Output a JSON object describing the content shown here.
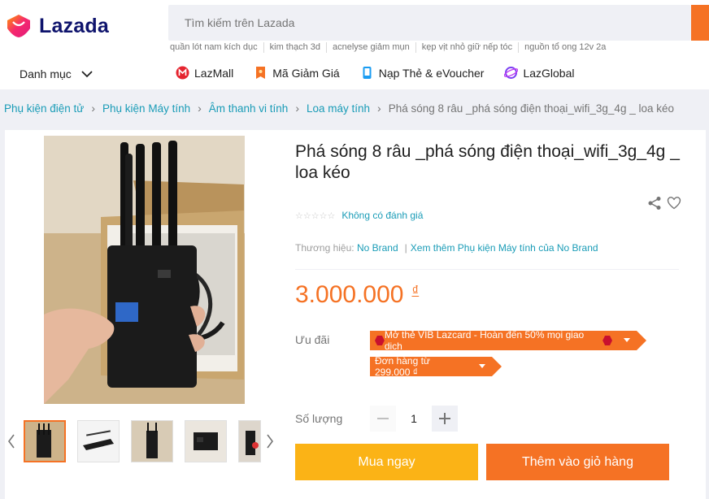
{
  "header": {
    "logo_text": "Lazada",
    "search_placeholder": "Tìm kiếm trên Lazada",
    "suggestions": [
      "quần lót nam kích dục",
      "kim thạch 3d",
      "acnelyse giảm mụn",
      "kẹp vịt nhỏ giữ nếp tóc",
      "nguồn tổ ong 12v 2a"
    ],
    "category_label": "Danh mục",
    "nav": [
      {
        "label": "LazMall",
        "icon": "lazmall-icon",
        "color": "#e5242f"
      },
      {
        "label": "Mã Giảm Giá",
        "icon": "voucher-icon",
        "color": "#f57224"
      },
      {
        "label": "Nạp Thẻ & eVoucher",
        "icon": "phone-topup-icon",
        "color": "#1a9cf2"
      },
      {
        "label": "LazGlobal",
        "icon": "lazglobal-icon",
        "color": "#7b3ff2"
      }
    ]
  },
  "breadcrumb": {
    "items": [
      "Phụ kiện điện tử",
      "Phụ kiện Máy tính",
      "Âm thanh vi tính",
      "Loa máy tính"
    ],
    "current": "Phá sóng 8 râu _phá sóng điện thoại_wifi_3g_4g _ loa kéo"
  },
  "product": {
    "title": "Phá sóng 8 râu _phá sóng điện thoại_wifi_3g_4g _ loa kéo",
    "rating_text": "Không có đánh giá",
    "brand_label": "Thương hiệu:",
    "brand": "No Brand",
    "brand_more": "Xem thêm Phụ kiện Máy tính của No Brand",
    "price": "3.000.000",
    "currency": "₫",
    "promo_label": "Ưu đãi",
    "vouchers": [
      "Mở thẻ VIB Lazcard - Hoàn đến 50% mọi giao dịch",
      "Đơn hàng từ 299.000 ₫"
    ],
    "quantity_label": "Số lượng",
    "quantity": "1",
    "buy_now": "Mua ngay",
    "add_to_cart": "Thêm vào giỏ hàng"
  },
  "colors": {
    "brand_orange": "#f57224",
    "buy_yellow": "#fbb316",
    "link_blue": "#1a9cb7",
    "logo_navy": "#0f146d"
  }
}
